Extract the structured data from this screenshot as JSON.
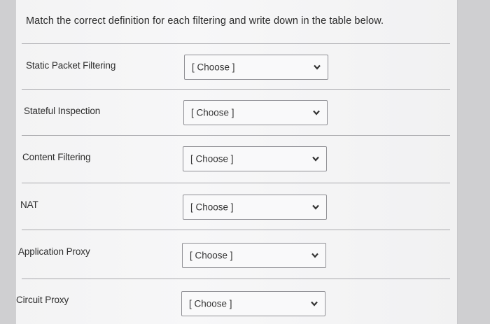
{
  "question": "Match the correct definition for each filtering and write down in the table below.",
  "rows": [
    {
      "label": "Static Packet Filtering",
      "selected": "[ Choose ]"
    },
    {
      "label": "Stateful Inspection",
      "selected": "[ Choose ]"
    },
    {
      "label": "Content Filtering",
      "selected": "[ Choose ]"
    },
    {
      "label": "NAT",
      "selected": "[ Choose ]"
    },
    {
      "label": "Application Proxy",
      "selected": "[ Choose ]"
    },
    {
      "label": "Circuit Proxy",
      "selected": "[ Choose ]"
    }
  ],
  "chevron_icon": "chevron-down-icon"
}
